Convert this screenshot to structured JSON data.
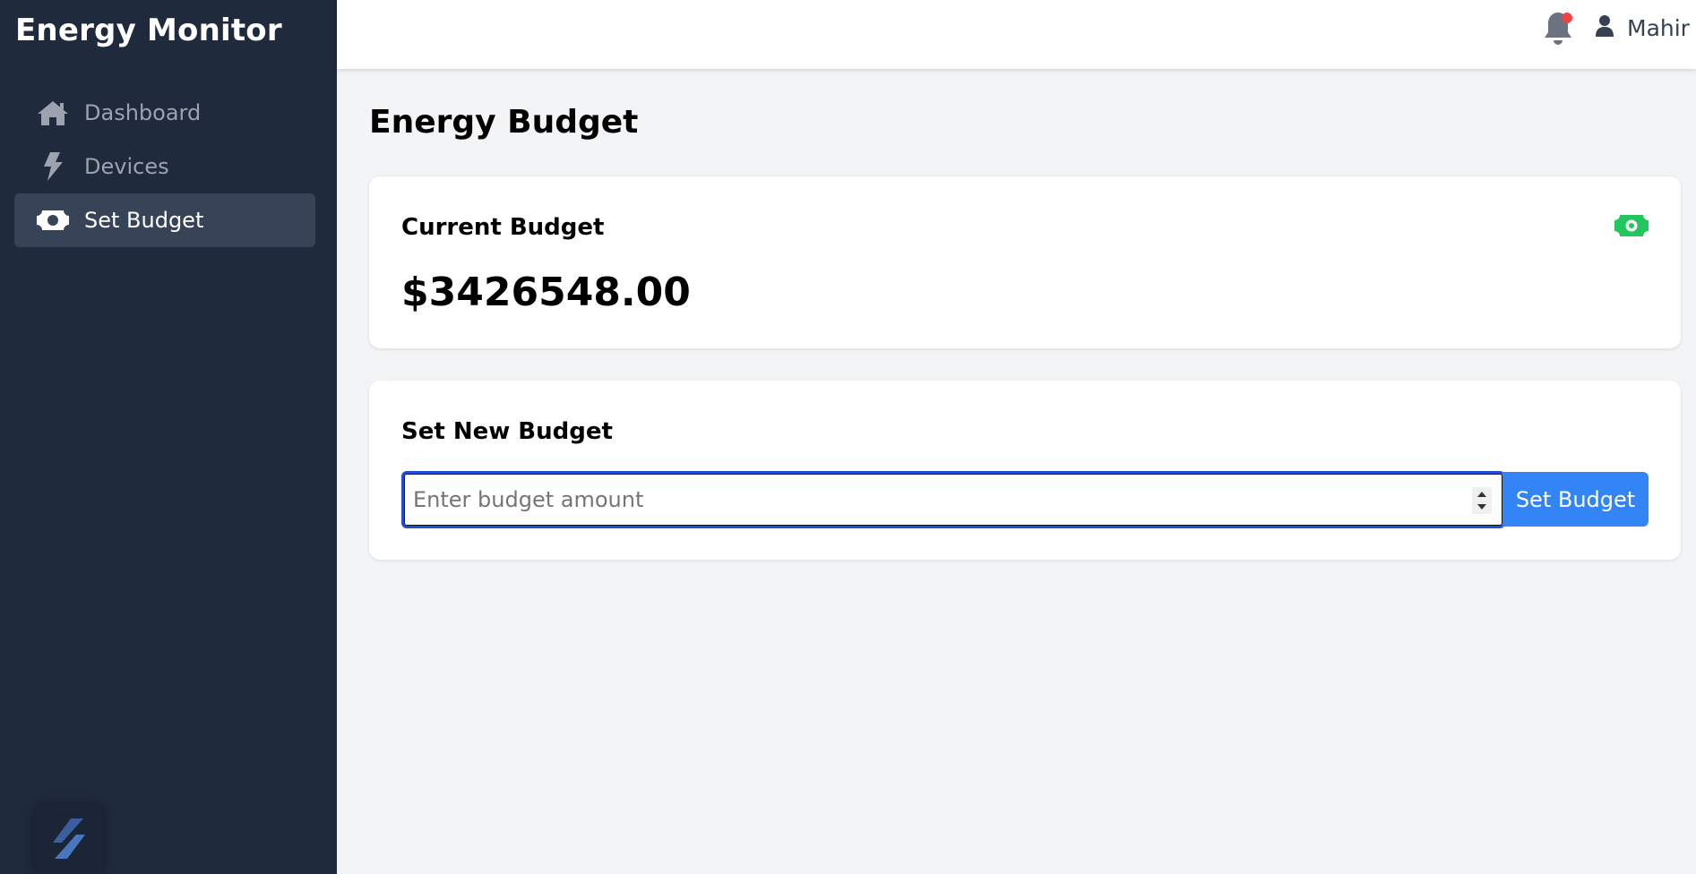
{
  "sidebar": {
    "app_title": "Energy Monitor",
    "items": [
      {
        "label": "Dashboard",
        "icon": "home-icon"
      },
      {
        "label": "Devices",
        "icon": "bolt-icon"
      },
      {
        "label": "Set Budget",
        "icon": "money-bill-icon",
        "active": true
      }
    ],
    "logo_icon": "app-logo-icon"
  },
  "header": {
    "notification_icon": "bell-icon",
    "has_unread_notifications": true,
    "user_icon": "user-icon",
    "user_name": "Mahir"
  },
  "main": {
    "page_title": "Energy Budget",
    "current_budget": {
      "title": "Current Budget",
      "value": "$3426548.00",
      "icon": "money-bill-icon"
    },
    "new_budget": {
      "title": "Set New Budget",
      "input_value": "",
      "input_placeholder": "Enter budget amount",
      "button_label": "Set Budget"
    }
  },
  "colors": {
    "sidebar_bg": "#1f2a3c",
    "active_item_bg": "#374357",
    "accent_blue": "#3385f5",
    "money_green": "#22c55e",
    "notification_dot": "#ef4444",
    "page_bg": "#f3f4f6"
  }
}
